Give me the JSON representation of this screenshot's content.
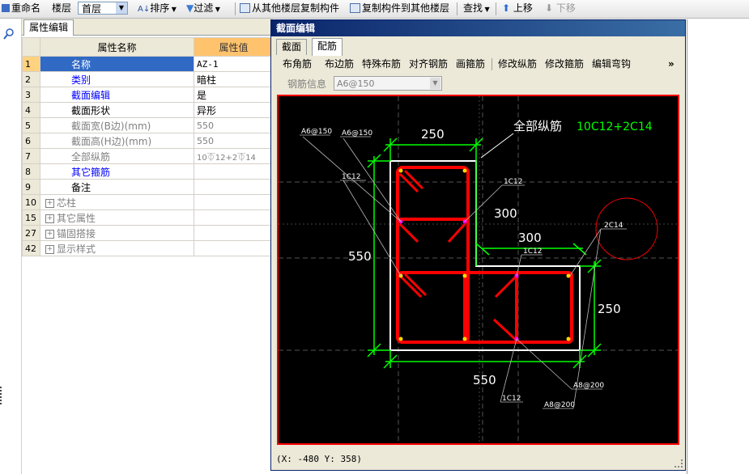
{
  "toolbar": {
    "rename": "重命名",
    "floor_label": "楼层",
    "floor_value": "首层",
    "sort": "排序",
    "filter": "过滤",
    "copy_from": "从其他楼层复制构件",
    "copy_to": "复制构件到其他楼层",
    "find": "查找",
    "move_up": "上移",
    "move_down": "下移"
  },
  "left_panel": {
    "tab": "属性编辑",
    "col_name": "属性名称",
    "col_value": "属性值",
    "rows": [
      {
        "num": "1",
        "name": "名称",
        "value": "AZ-1"
      },
      {
        "num": "2",
        "name": "类别",
        "value": "暗柱"
      },
      {
        "num": "3",
        "name": "截面编辑",
        "value": "是"
      },
      {
        "num": "4",
        "name": "截面形状",
        "value": "异形"
      },
      {
        "num": "5",
        "name": "截面宽(B边)(mm)",
        "value": "550"
      },
      {
        "num": "6",
        "name": "截面高(H边)(mm)",
        "value": "550"
      },
      {
        "num": "7",
        "name": "全部纵筋",
        "value": "10⏁12+2⏁14"
      },
      {
        "num": "8",
        "name": "其它箍筋",
        "value": ""
      },
      {
        "num": "9",
        "name": "备注",
        "value": ""
      },
      {
        "num": "10",
        "name": "芯柱",
        "value": ""
      },
      {
        "num": "15",
        "name": "其它属性",
        "value": ""
      },
      {
        "num": "27",
        "name": "锚固搭接",
        "value": ""
      },
      {
        "num": "42",
        "name": "显示样式",
        "value": ""
      }
    ]
  },
  "dialog": {
    "title": "截面编辑",
    "tabs": [
      "截面",
      "配筋"
    ],
    "tools": [
      "布角筋",
      "布边筋",
      "特殊布筋",
      "对齐钢筋",
      "画箍筋",
      "修改纵筋",
      "修改箍筋",
      "编辑弯钩"
    ],
    "more": "»",
    "rebar_info_label": "钢筋信息",
    "rebar_info_value": "A6@150",
    "status": "(X: -480 Y: 358)"
  },
  "drawing": {
    "dim_top": "250",
    "dim_left": "550",
    "dim_bottom": "550",
    "dim_right": "250",
    "dim_inner_300_a": "300",
    "dim_inner_300_b": "300",
    "all_rebar_label": "全部纵筋",
    "all_rebar_value": "10C12+2C14",
    "lbl_a6_1": "A6@150",
    "lbl_a6_2": "A6@150",
    "lbl_1c12_a": "1C12",
    "lbl_1c12_b": "1C12",
    "lbl_1c12_c": "1C12",
    "lbl_1c12_d": "1C12",
    "lbl_2c14": "2C14",
    "lbl_a8_1": "A8@200",
    "lbl_a8_2": "A8@200",
    "colors": {
      "rebar": "#ff0000",
      "dimension": "#00ff00",
      "outline": "#ffffff",
      "background": "#000000"
    }
  }
}
